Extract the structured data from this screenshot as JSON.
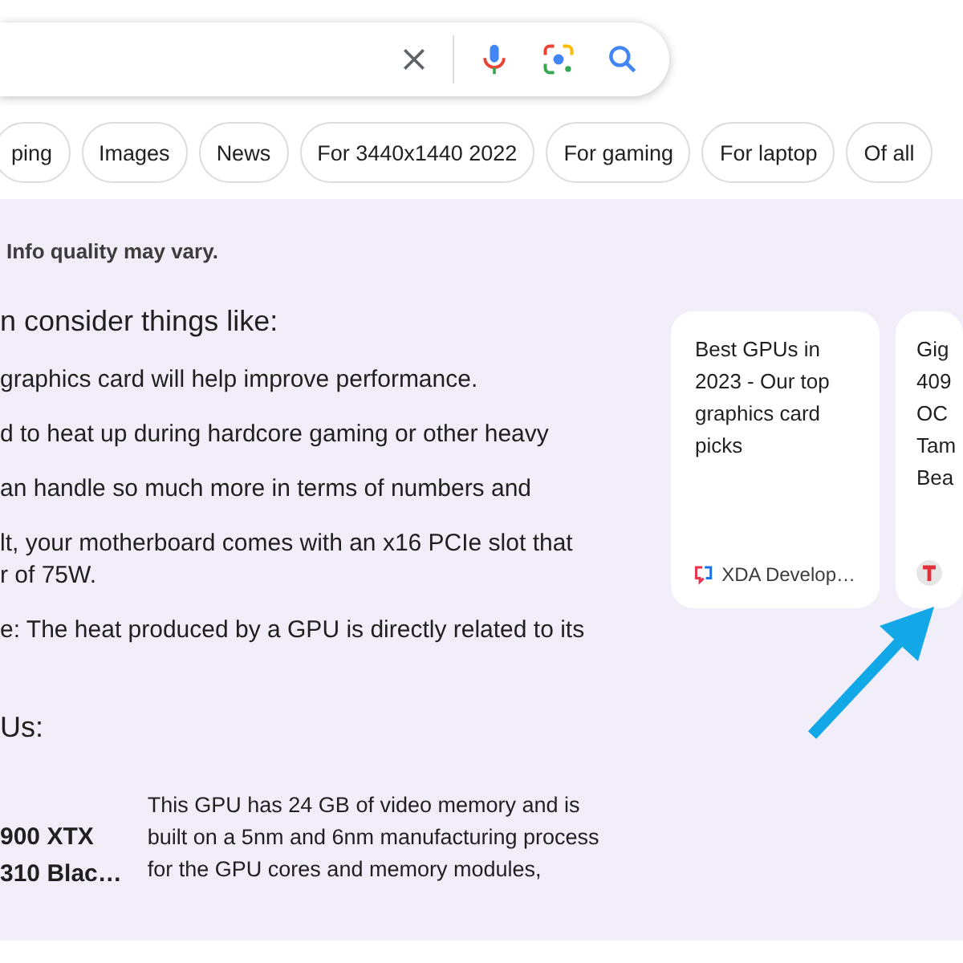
{
  "filter_chips": [
    "ping",
    "Images",
    "News",
    "For 3440x1440 2022",
    "For gaming",
    "For laptop",
    "Of all"
  ],
  "overview": {
    "notice": "Info quality may vary.",
    "heading": "n consider things like:",
    "points": [
      {
        "lines": [
          "graphics card will help improve performance."
        ]
      },
      {
        "lines": [
          "d to heat up during hardcore gaming or other heavy"
        ]
      },
      {
        "lines": [
          "an handle so much more in terms of numbers and"
        ]
      },
      {
        "lines": [
          "lt, your motherboard comes with an x16 PCIe slot that",
          "r of 75W."
        ]
      },
      {
        "lines": [
          "e: The heat produced by a GPU is directly related to its"
        ]
      }
    ],
    "subheading": "Us:",
    "product": {
      "name_lines": [
        "900 XTX",
        "310 Blac…"
      ],
      "description": "This GPU has 24 GB of video memory and is\nbuilt on a 5nm and 6nm manufacturing process\nfor the GPU cores and memory modules,"
    }
  },
  "sources": [
    {
      "kind": "xda",
      "title_lines": [
        "Best GPUs in",
        "2023 - Our top",
        "graphics card",
        "picks"
      ],
      "source": "XDA Develop…"
    },
    {
      "kind": "t",
      "title_lines": [
        "Gig",
        "409",
        "OC",
        "Tam",
        "Bea"
      ]
    }
  ]
}
